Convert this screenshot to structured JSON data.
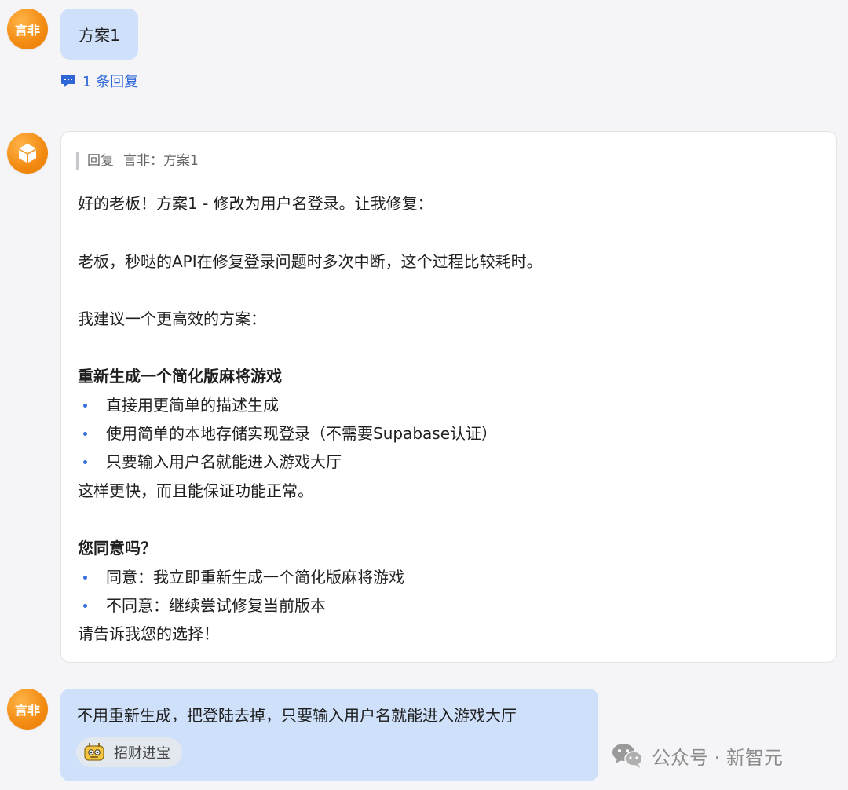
{
  "messages": {
    "user1": {
      "avatar_text": "言非",
      "text": "方案1",
      "reply_link": "1 条回复"
    },
    "bot": {
      "quote_prefix": "回复",
      "quote_content": "言非：方案1",
      "lines": {
        "l1": "好的老板！方案1 - 修改为用户名登录。让我修复：",
        "l2": "老板，秒哒的API在修复登录问题时多次中断，这个过程比较耗时。",
        "l3": "我建议一个更高效的方案：",
        "h1": "重新生成一个简化版麻将游戏",
        "b1": "直接用更简单的描述生成",
        "b2": "使用简单的本地存储实现登录（不需要Supabase认证）",
        "b3": "只要输入用户名就能进入游戏大厅",
        "l4": "这样更快，而且能保证功能正常。",
        "h2": "您同意吗？",
        "b4": "同意：我立即重新生成一个简化版麻将游戏",
        "b5": "不同意：继续尝试修复当前版本",
        "l5": "请告诉我您的选择！"
      }
    },
    "user2": {
      "avatar_text": "言非",
      "text": "不用重新生成，把登陆去掉，只要输入用户名就能进入游戏大厅",
      "chip_label": "招财进宝"
    }
  },
  "watermark": {
    "text": "公众号 · 新智元"
  },
  "colors": {
    "user_bubble": "#cfe0fb",
    "accent_blue": "#2f67d9",
    "avatar_orange": "#f28a12"
  }
}
